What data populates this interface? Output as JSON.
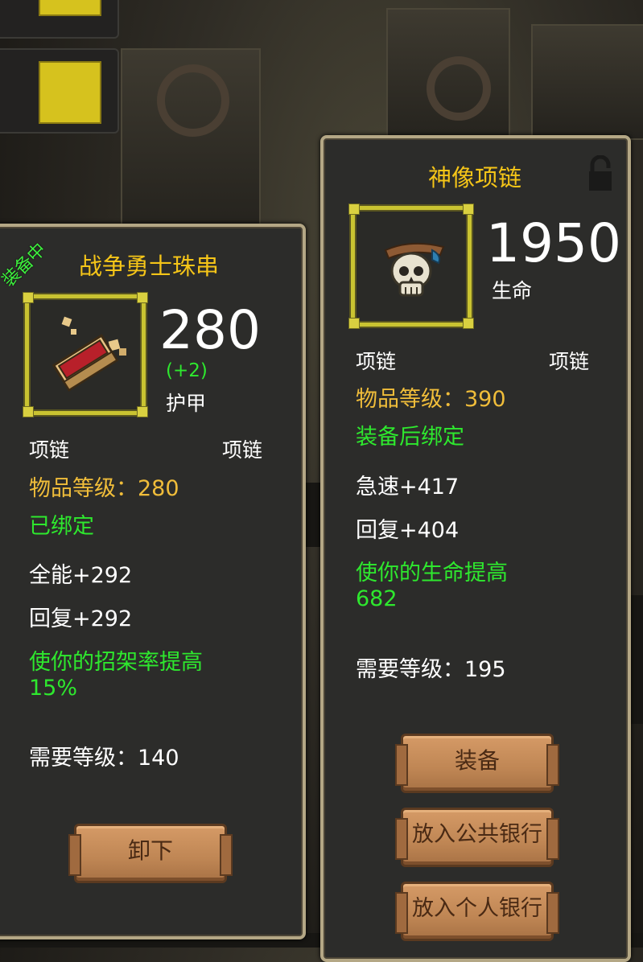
{
  "left_panel": {
    "equipped_tag": "装备中",
    "name": "战争勇士珠串",
    "icon": "brick-relic-icon",
    "main_stat_value": "280",
    "main_stat_bonus": "(+2)",
    "main_stat_label": "护甲",
    "type_left": "项链",
    "type_right": "项链",
    "item_level": "物品等级：280",
    "bind_status": "已绑定",
    "stats": [
      "全能+292",
      "回复+292"
    ],
    "effect_line1": "使你的招架率提高",
    "effect_line2": "15%",
    "required_level": "需要等级：140",
    "button_unequip": "卸下"
  },
  "right_panel": {
    "name": "神像项链",
    "icon": "skull-necklace-icon",
    "lock_icon": "lock-icon",
    "main_stat_value": "1950",
    "main_stat_label": "生命",
    "type_left": "项链",
    "type_right": "项链",
    "item_level": "物品等级：390",
    "bind_status": "装备后绑定",
    "stats": [
      "急速+417",
      "回复+404"
    ],
    "effect_line1": "使你的生命提高",
    "effect_line2": "682",
    "required_level": "需要等级：195",
    "button_equip": "装备",
    "button_public_bank": "放入公共银行",
    "button_personal_bank": "放入个人银行"
  },
  "colors": {
    "title": "#f5c518",
    "item_level": "#f0bd3a",
    "green": "#2ee82e",
    "panel_bg": "#2c2c2a",
    "panel_border": "#b4a785",
    "button": "#c88c5a"
  }
}
